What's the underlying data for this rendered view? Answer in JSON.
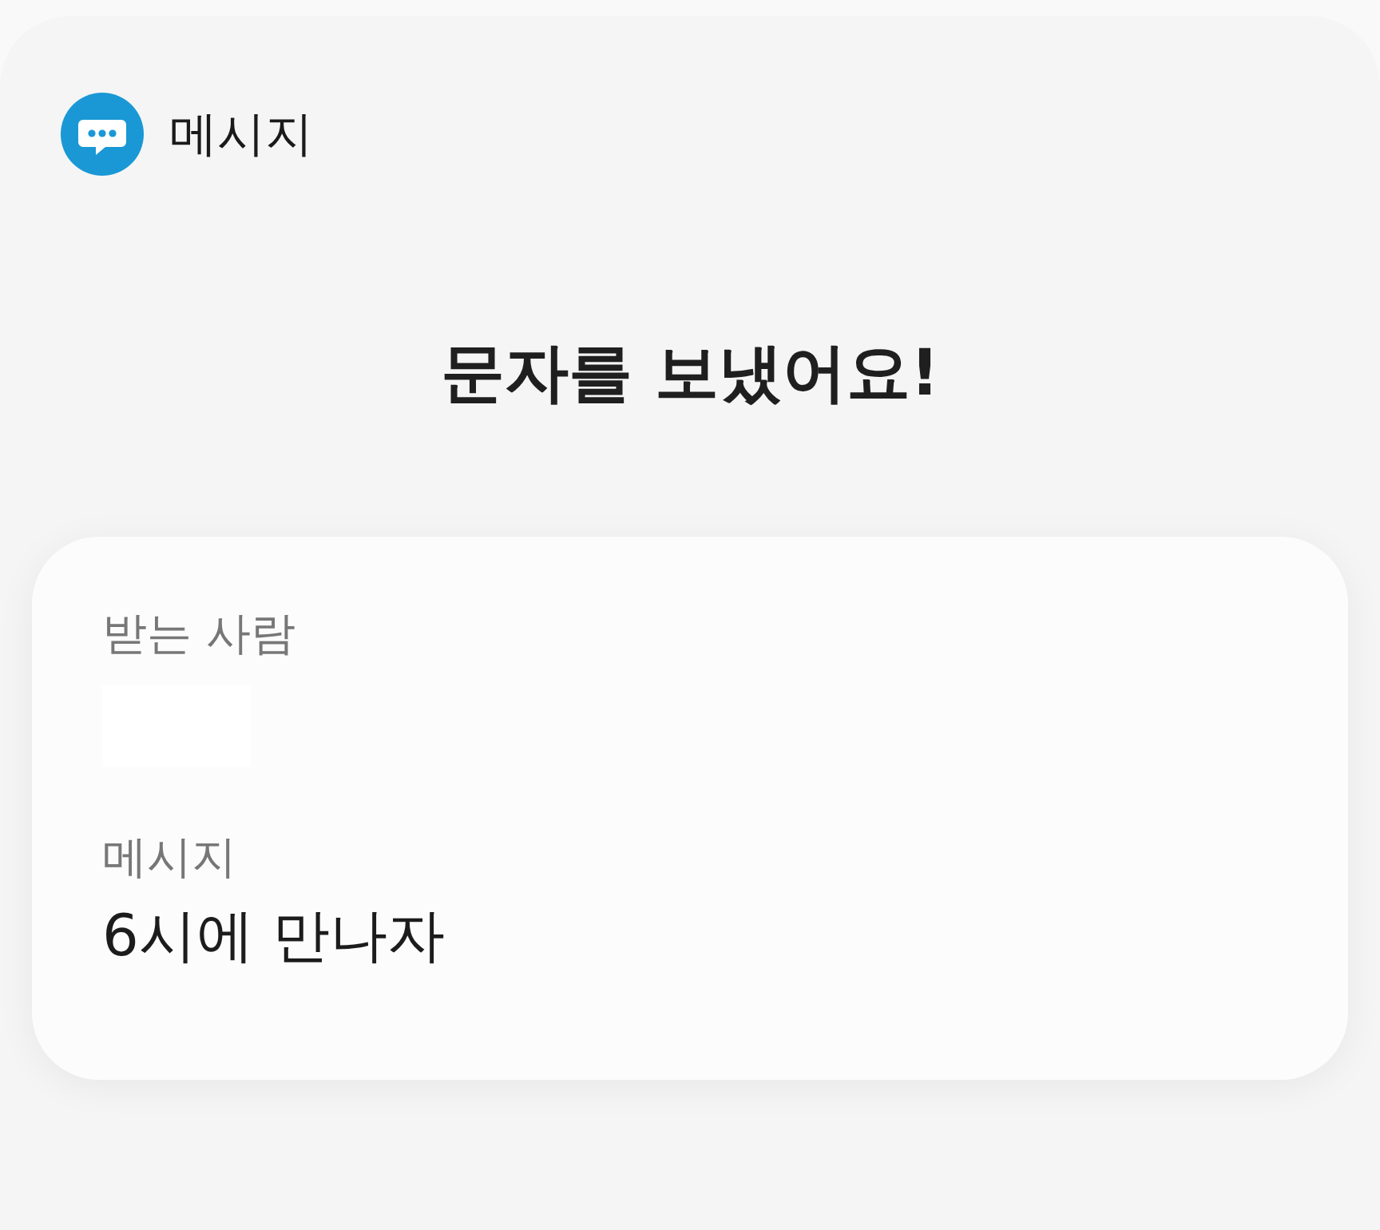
{
  "app": {
    "name": "메시지"
  },
  "title": "문자를 보냈어요!",
  "card": {
    "recipient_label": "받는 사람",
    "message_label": "메시지",
    "message": "6시에 만나자"
  }
}
